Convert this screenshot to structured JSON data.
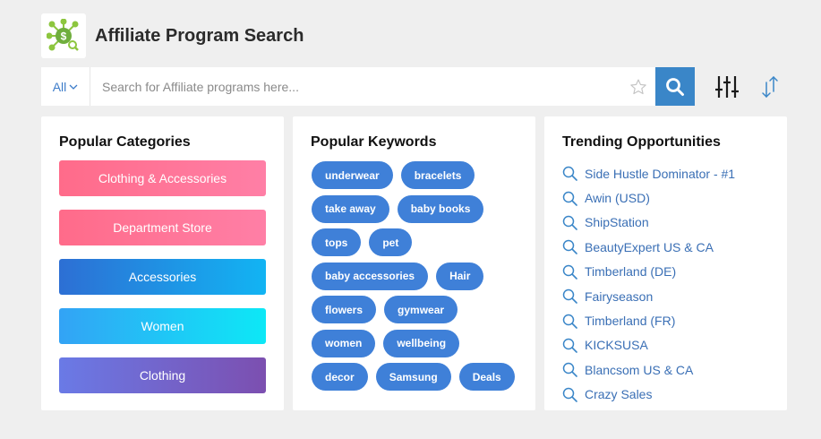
{
  "header": {
    "title": "Affiliate Program Search",
    "logo_icon": "dollar-network-icon"
  },
  "search": {
    "scope_label": "All",
    "placeholder": "Search for Affiliate programs here...",
    "value": ""
  },
  "colors": {
    "accent": "#3a86c8",
    "link": "#3a6fb5",
    "keyword_bg": "#3f80d8"
  },
  "categories": {
    "title": "Popular Categories",
    "items": [
      "Clothing & Accessories",
      "Department Store",
      "Accessories",
      "Women",
      "Clothing"
    ]
  },
  "keywords": {
    "title": "Popular Keywords",
    "items": [
      "underwear",
      "bracelets",
      "take away",
      "baby books",
      "tops",
      "pet",
      "baby accessories",
      "Hair",
      "flowers",
      "gymwear",
      "women",
      "wellbeing",
      "decor",
      "Samsung",
      "Deals"
    ]
  },
  "trending": {
    "title": "Trending Opportunities",
    "items": [
      "Side Hustle Dominator - #1",
      "Awin (USD)",
      "ShipStation",
      "BeautyExpert US & CA",
      "Timberland (DE)",
      "Fairyseason",
      "Timberland (FR)",
      "KICKSUSA",
      "Blancsom US & CA",
      "Crazy Sales"
    ]
  }
}
